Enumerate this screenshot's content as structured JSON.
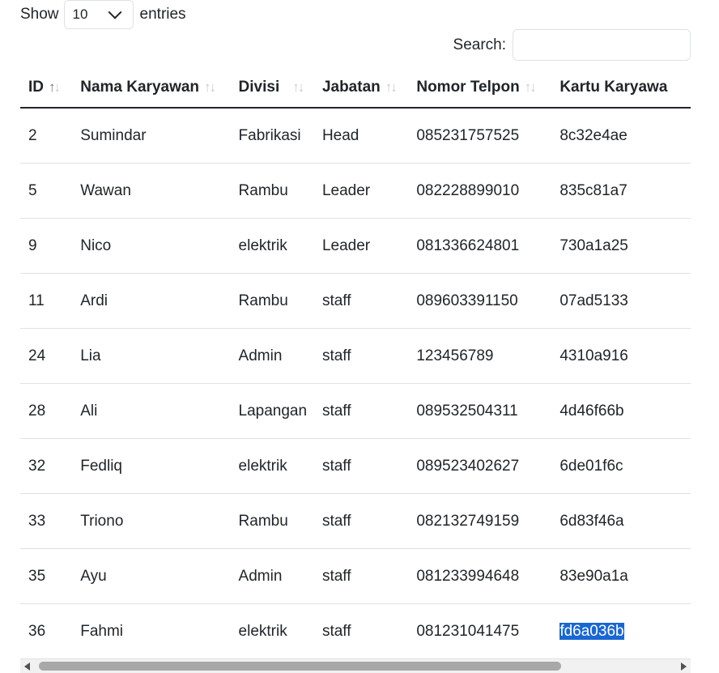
{
  "length": {
    "prefix": "Show",
    "selected": "10",
    "suffix": "entries"
  },
  "search": {
    "label": "Search:",
    "value": ""
  },
  "table": {
    "columns": [
      {
        "label": "ID",
        "sort": "asc"
      },
      {
        "label": "Nama Karyawan",
        "sort": "none"
      },
      {
        "label": "Divisi",
        "sort": "none"
      },
      {
        "label": "Jabatan",
        "sort": "none"
      },
      {
        "label": "Nomor Telpon",
        "sort": "none"
      },
      {
        "label": "Kartu Karyawa",
        "sort": "none"
      }
    ],
    "rows": [
      [
        "2",
        "Sumindar",
        "Fabrikasi",
        "Head",
        "085231757525",
        "8c32e4ae"
      ],
      [
        "5",
        "Wawan",
        "Rambu",
        "Leader",
        "082228899010",
        "835c81a7"
      ],
      [
        "9",
        "Nico",
        "elektrik",
        "Leader",
        "081336624801",
        "730a1a25"
      ],
      [
        "11",
        "Ardi",
        "Rambu",
        "staff",
        "089603391150",
        "07ad5133"
      ],
      [
        "24",
        "Lia",
        "Admin",
        "staff",
        "123456789",
        "4310a916"
      ],
      [
        "28",
        "Ali",
        "Lapangan",
        "staff",
        "089532504311",
        "4d46f66b"
      ],
      [
        "32",
        "Fedliq",
        "elektrik",
        "staff",
        "089523402627",
        "6de01f6c"
      ],
      [
        "33",
        "Triono",
        "Rambu",
        "staff",
        "082132749159",
        "6d83f46a"
      ],
      [
        "35",
        "Ayu",
        "Admin",
        "staff",
        "081233994648",
        "83e90a1a"
      ],
      [
        "36",
        "Fahmi",
        "elektrik",
        "staff",
        "081231041475",
        "fd6a036b"
      ]
    ]
  },
  "colors": {
    "selection": "#1967d2",
    "border": "#dee2e6",
    "text": "#212529"
  }
}
